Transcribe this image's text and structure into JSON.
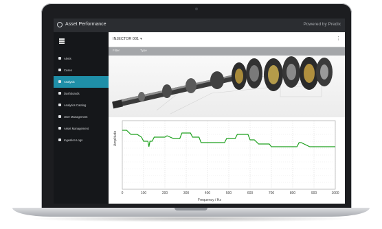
{
  "app": {
    "title": "Asset Performance",
    "powered_by": "Powered by Predix"
  },
  "sidebar": {
    "items": [
      {
        "label": "Alerts",
        "icon": "warning-icon",
        "active": false
      },
      {
        "label": "Cases",
        "icon": "briefcase-icon",
        "active": false
      },
      {
        "label": "Analysis",
        "icon": "chart-icon",
        "active": true
      },
      {
        "label": "Dashboards",
        "icon": "dashboard-icon",
        "active": false
      },
      {
        "label": "Analytics Catalog",
        "icon": "wrench-icon",
        "active": false
      },
      {
        "label": "User Management",
        "icon": "users-icon",
        "active": false
      },
      {
        "label": "Asset Management",
        "icon": "cog-icon",
        "active": false
      },
      {
        "label": "Ingestion Logs",
        "icon": "log-icon",
        "active": false
      }
    ]
  },
  "toolbar": {
    "asset_select": "INJECTOR 001"
  },
  "tabs": [
    "Filter",
    "Type"
  ],
  "chart_data": {
    "type": "line",
    "xlabel": "Frequency / Hz",
    "ylabel": "Amplitude",
    "xlim": [
      0,
      1000
    ],
    "x_ticks": [
      0,
      100,
      200,
      300,
      400,
      500,
      600,
      700,
      800,
      900,
      1000
    ],
    "grid": true,
    "series": [
      {
        "color": "#1ea01e",
        "x": [
          0,
          20,
          40,
          70,
          90,
          100,
          110,
          120,
          125,
          130,
          140,
          150,
          160,
          200,
          210,
          240,
          270,
          280,
          320,
          330,
          360,
          370,
          410,
          420,
          480,
          490,
          530,
          540,
          560,
          590,
          600,
          620,
          640,
          660,
          690,
          700,
          760,
          770,
          820,
          830,
          840,
          880,
          890,
          1000
        ],
        "y": [
          0.86,
          0.86,
          0.8,
          0.8,
          0.76,
          0.7,
          0.7,
          0.7,
          0.62,
          0.7,
          0.7,
          0.76,
          0.76,
          0.76,
          0.78,
          0.74,
          0.74,
          0.82,
          0.82,
          0.76,
          0.76,
          0.68,
          0.68,
          0.68,
          0.68,
          0.74,
          0.74,
          0.8,
          0.8,
          0.8,
          0.72,
          0.72,
          0.66,
          0.66,
          0.66,
          0.62,
          0.62,
          0.62,
          0.62,
          0.68,
          0.68,
          0.62,
          0.62,
          0.62
        ]
      }
    ]
  }
}
